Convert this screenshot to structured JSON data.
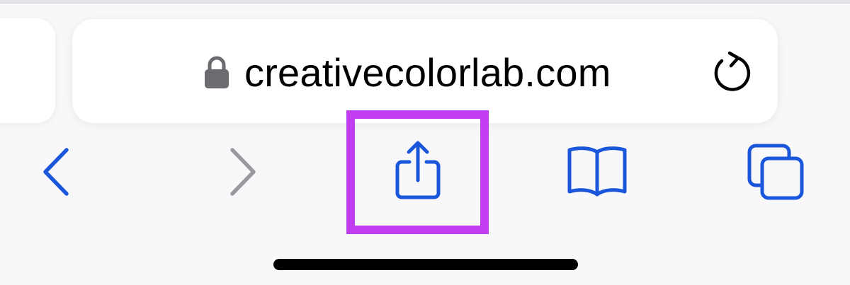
{
  "address_bar": {
    "url": "creativecolorlab.com",
    "lock_icon": "lock-icon",
    "reload_icon": "reload-icon"
  },
  "toolbar": {
    "back_icon": "chevron-left-icon",
    "forward_icon": "chevron-right-icon",
    "share_icon": "share-icon",
    "bookmarks_icon": "book-icon",
    "tabs_icon": "tabs-icon"
  },
  "colors": {
    "accent": "#1a56d9",
    "disabled": "#9a9a9e",
    "highlight": "#c03ef0",
    "lock": "#6b6b70",
    "background": "#f8f8fa"
  }
}
